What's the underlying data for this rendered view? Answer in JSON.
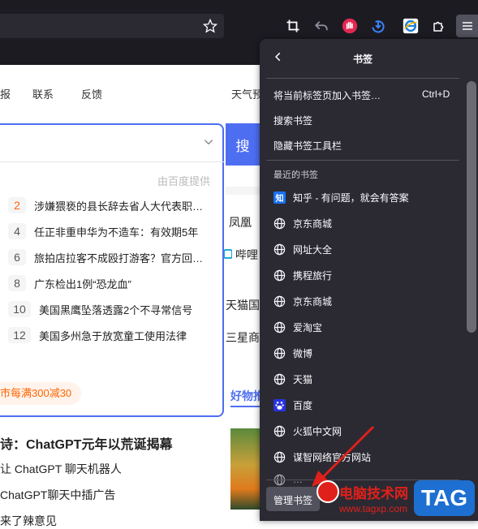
{
  "toolbar": {
    "bookmark_star_icon": "star-outline",
    "icons": [
      "crop-icon",
      "undo-icon",
      "hand-shield-icon",
      "download-icon",
      "ie-logo-icon",
      "puzzle-extension-icon",
      "hamburger-menu-icon"
    ]
  },
  "page": {
    "nav": [
      "报",
      "联系",
      "反馈",
      "天气预"
    ],
    "source_note": "由百度提供",
    "search_button": "搜",
    "hot_list": [
      {
        "rank": "2",
        "text": "涉嫌猥亵的县长辞去省人大代表职…",
        "hot": true
      },
      {
        "rank": "4",
        "text": "任正非重申华为不造车：有效期5年",
        "hot": false
      },
      {
        "rank": "6",
        "text": "旅拍店拉客不成殴打游客？官方回…",
        "hot": false
      },
      {
        "rank": "8",
        "text": "广东检出1例“恐龙血”",
        "hot": false
      },
      {
        "rank": "10",
        "text": "美国黑鹰坠落透露2个不寻常信号",
        "hot": false
      },
      {
        "rank": "12",
        "text": "美国多州急于放宽童工使用法律",
        "hot": false
      }
    ],
    "promo": "市每满300减30",
    "side_links": [
      "凤凰",
      "哔哩",
      "天猫国",
      "三星商"
    ],
    "good_things": "好物推",
    "bottom_lines": [
      "诗：ChatGPT元年以荒诞揭幕",
      "让 ChatGPT 聊天机器人",
      "ChatGPT聊天中插广告",
      "来了辣意见"
    ]
  },
  "panel": {
    "title": "书签",
    "back_icon": "chevron-left",
    "add_bookmark": "将当前标签页加入书签…",
    "add_shortcut": "Ctrl+D",
    "search_bookmarks": "搜索书签",
    "hide_toolbar": "隐藏书签工具栏",
    "recent_heading": "最近的书签",
    "bookmarks": [
      {
        "label": "知乎 - 有问题，就会有答案",
        "icon": "zhihu-icon"
      },
      {
        "label": "京东商城",
        "icon": "globe-icon"
      },
      {
        "label": "网址大全",
        "icon": "globe-icon"
      },
      {
        "label": "携程旅行",
        "icon": "globe-icon"
      },
      {
        "label": "京东商城",
        "icon": "globe-icon"
      },
      {
        "label": "爱淘宝",
        "icon": "globe-icon"
      },
      {
        "label": "微博",
        "icon": "globe-icon"
      },
      {
        "label": "天猫",
        "icon": "globe-icon"
      },
      {
        "label": "百度",
        "icon": "baidu-icon"
      },
      {
        "label": "火狐中文网",
        "icon": "globe-icon"
      },
      {
        "label": "谋智网络官方网站",
        "icon": "globe-icon"
      },
      {
        "label": "…",
        "icon": "globe-icon"
      }
    ],
    "manage": "管理书签"
  },
  "watermark": {
    "site_name": "电脑技术网",
    "site_url": "www.tagxp.com",
    "tag": "TAG"
  },
  "colors": {
    "accent": "#4e6ef2",
    "panel_bg": "#2b2a33",
    "toolbar_bg": "#1c1b22",
    "arrow": "#e0201a"
  }
}
